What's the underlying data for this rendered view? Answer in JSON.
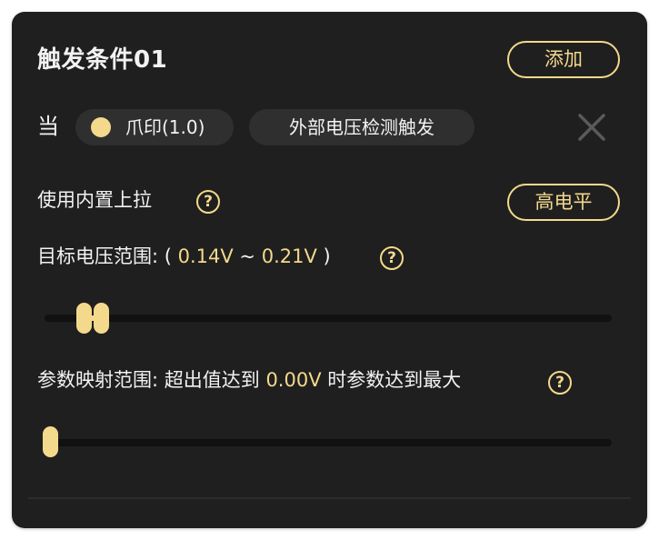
{
  "trigger": {
    "title": "触发条件01",
    "add_label": "添加",
    "when_label": "当",
    "device_chip": "爪印(1.0)",
    "trigger_chip": "外部电压检测触发"
  },
  "pullup": {
    "label": "使用内置上拉",
    "level_label": "高电平"
  },
  "voltage": {
    "label_prefix": "目标电压范围: ( ",
    "min": "0.14V",
    "separator": " ~ ",
    "max": "0.21V",
    "label_suffix": " )",
    "range_fraction": [
      0.07,
      0.1
    ]
  },
  "mapping": {
    "label_prefix": "参数映射范围: 超出值达到 ",
    "value": "0.00V",
    "label_suffix": " 时参数达到最大",
    "value_fraction": 0.0
  },
  "help_symbol": "?",
  "colors": {
    "accent": "#f4d98c",
    "card_bg": "#1f1f1f",
    "chip_bg": "#2f2f2f",
    "track": "#111111"
  },
  "icons": {
    "close": "close-icon",
    "help": "question-circle-icon",
    "status_dot": "dot-icon"
  }
}
